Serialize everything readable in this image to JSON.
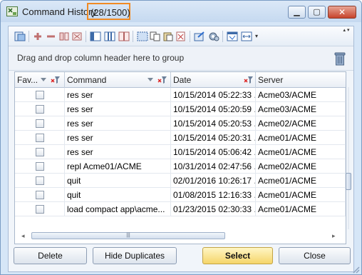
{
  "window": {
    "title": "Command History",
    "count": "(28/1500)",
    "minimize_glyph": "▁",
    "maximize_glyph": "▢",
    "close_glyph": "✕"
  },
  "toolbar": {
    "icons": [
      "export-icon",
      "add-row-icon",
      "remove-row-icon",
      "insert-column-icon",
      "delete-column-icon",
      "column-layout-icon",
      "column-view-icon",
      "column-split-icon",
      "select-all-icon",
      "copy-icon",
      "paste-icon",
      "clear-icon",
      "send-icon",
      "settings-icon",
      "window-icon",
      "fit-columns-icon"
    ],
    "dropdown_glyph": "▾",
    "scroll_glyph": "▴ ▾"
  },
  "group_panel": {
    "text": "Drag and drop column header here to group"
  },
  "grid": {
    "columns": [
      "Fav...",
      "Command",
      "Date",
      "Server"
    ],
    "rows": [
      {
        "command": "res ser",
        "date": "10/15/2014 05:22:33 ...",
        "server": "Acme03/ACME"
      },
      {
        "command": "res ser",
        "date": "10/15/2014 05:20:59 ...",
        "server": "Acme03/ACME"
      },
      {
        "command": "res ser",
        "date": "10/15/2014 05:20:53 ...",
        "server": "Acme02/ACME"
      },
      {
        "command": "res ser",
        "date": "10/15/2014 05:20:31 ...",
        "server": "Acme01/ACME"
      },
      {
        "command": "res ser",
        "date": "10/15/2014 05:06:42 ...",
        "server": "Acme01/ACME"
      },
      {
        "command": "repl Acme01/ACME",
        "date": "10/31/2014 02:47:56 ...",
        "server": "Acme02/ACME"
      },
      {
        "command": "quit",
        "date": "02/01/2016 10:26:17 ...",
        "server": "Acme01/ACME"
      },
      {
        "command": "quit",
        "date": "01/08/2015 12:16:33 ...",
        "server": "Acme01/ACME"
      },
      {
        "command": "load compact app\\acme...",
        "date": "01/23/2015 02:30:33 ...",
        "server": "Acme01/ACME"
      }
    ],
    "hscroll_left": "◂",
    "hscroll_right": "▸",
    "hscroll_grip": "|||"
  },
  "buttons": {
    "delete": "Delete",
    "hide_duplicates": "Hide Duplicates",
    "select": "Select",
    "close": "Close"
  },
  "colors": {
    "count_highlight": "#f08a24",
    "primary_button": "#f5d56a",
    "title_bar": "#c9ddf3"
  }
}
